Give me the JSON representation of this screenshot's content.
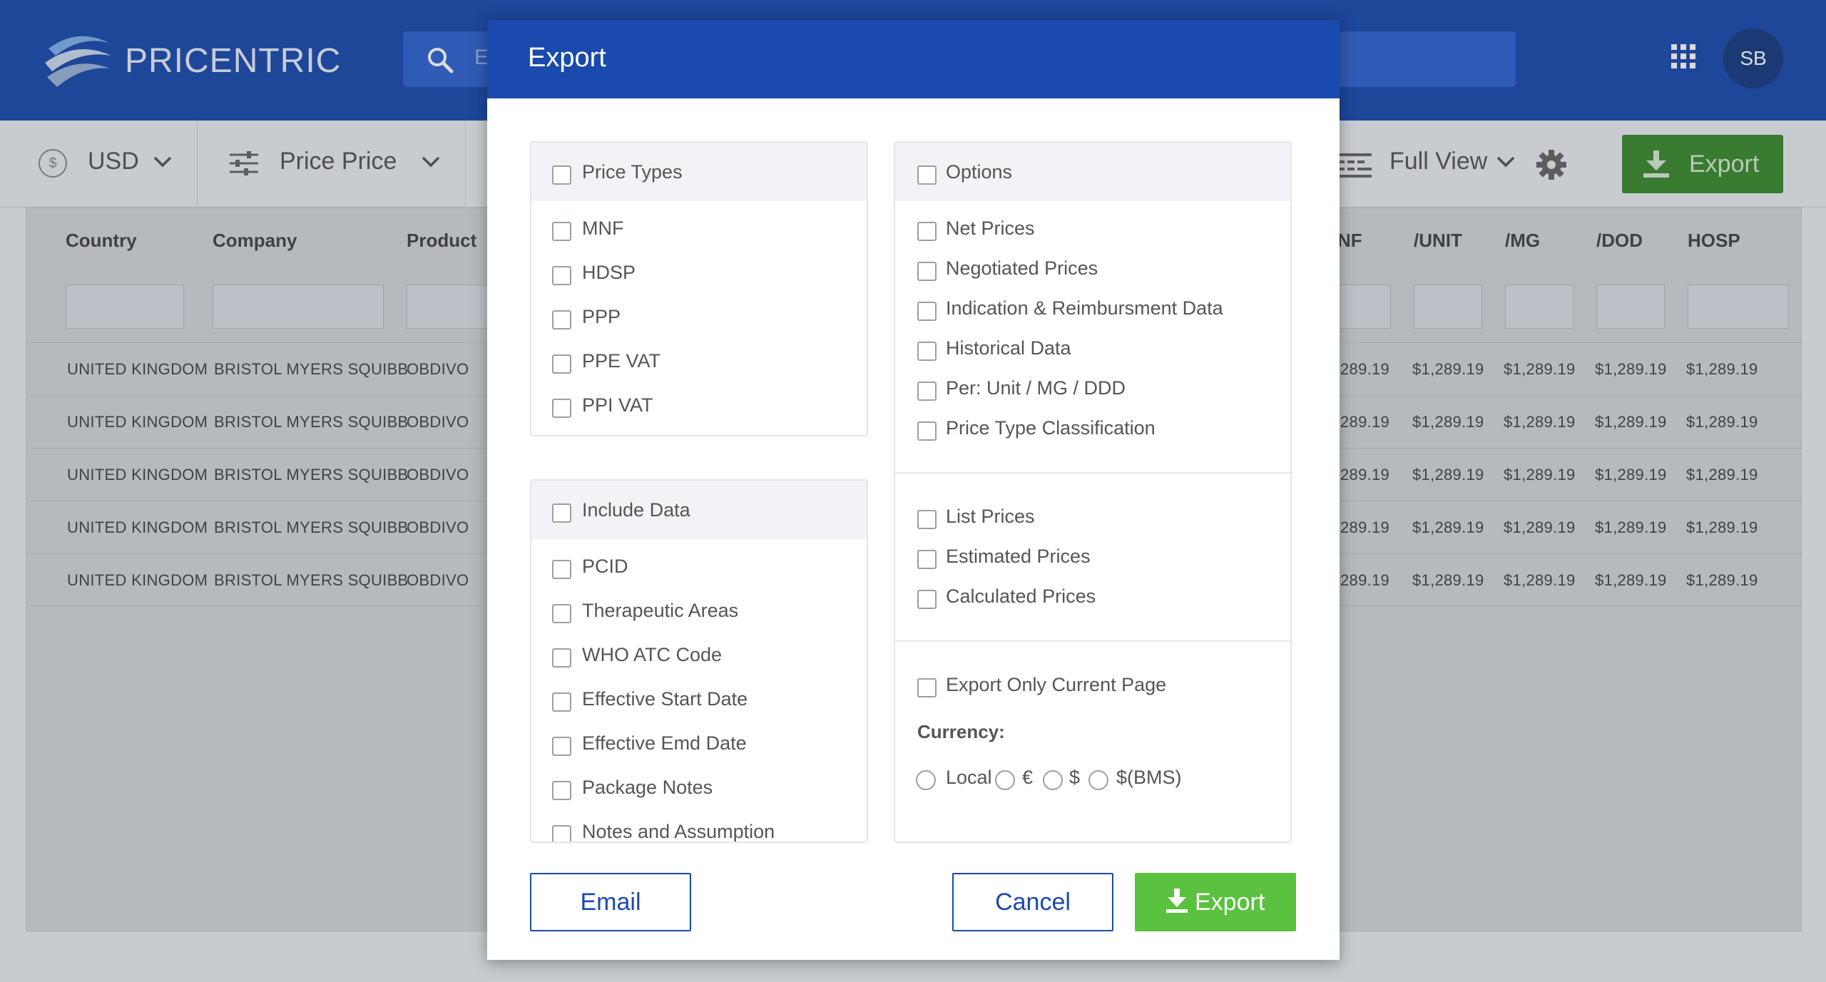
{
  "header": {
    "brand": "PRICENTRIC",
    "search_placeholder": "E",
    "avatar_initials": "SB"
  },
  "toolbar": {
    "currency": "USD",
    "price_type": "Price Price",
    "view": "Full View",
    "export_label": "Export"
  },
  "table": {
    "columns": [
      "Country",
      "Company",
      "Product",
      "NF",
      "/UNIT",
      "/MG",
      "/DOD",
      "HOSP"
    ],
    "rows": [
      [
        "UNITED KINGDOM",
        "BRISTOL MYERS SQUIBB",
        "OBDIVO",
        "289.19",
        "$1,289.19",
        "$1,289.19",
        "$1,289.19",
        "$1,289.19"
      ],
      [
        "UNITED KINGDOM",
        "BRISTOL MYERS SQUIBB",
        "OBDIVO",
        "289.19",
        "$1,289.19",
        "$1,289.19",
        "$1,289.19",
        "$1,289.19"
      ],
      [
        "UNITED KINGDOM",
        "BRISTOL MYERS SQUIBB",
        "OBDIVO",
        "289.19",
        "$1,289.19",
        "$1,289.19",
        "$1,289.19",
        "$1,289.19"
      ],
      [
        "UNITED KINGDOM",
        "BRISTOL MYERS SQUIBB",
        "OBDIVO",
        "289.19",
        "$1,289.19",
        "$1,289.19",
        "$1,289.19",
        "$1,289.19"
      ],
      [
        "UNITED KINGDOM",
        "BRISTOL MYERS SQUIBB",
        "OBDIVO",
        "289.19",
        "$1,289.19",
        "$1,289.19",
        "$1,289.19",
        "$1,289.19"
      ]
    ]
  },
  "modal": {
    "title": "Export",
    "price_types": {
      "title": "Price Types",
      "items": [
        "MNF",
        "HDSP",
        "PPP",
        "PPE VAT",
        "PPI VAT"
      ]
    },
    "include_data": {
      "title": "Include Data",
      "items": [
        "PCID",
        "Therapeutic Areas",
        "WHO ATC Code",
        "Effective Start Date",
        "Effective Emd Date",
        "Package Notes",
        "Notes and Assumption"
      ]
    },
    "options": {
      "title": "Options",
      "group1": [
        "Net Prices",
        "Negotiated Prices",
        "Indication & Reimbursment Data",
        "Historical Data",
        "Per: Unit / MG / DDD",
        "Price Type Classification"
      ],
      "group2": [
        "List Prices",
        "Estimated Prices",
        "Calculated Prices"
      ],
      "current_page": "Export Only Current Page",
      "currency_label": "Currency:",
      "currency_options": [
        "Local",
        "€",
        "$",
        "$(BMS)"
      ]
    },
    "buttons": {
      "email": "Email",
      "cancel": "Cancel",
      "export": "Export"
    }
  }
}
